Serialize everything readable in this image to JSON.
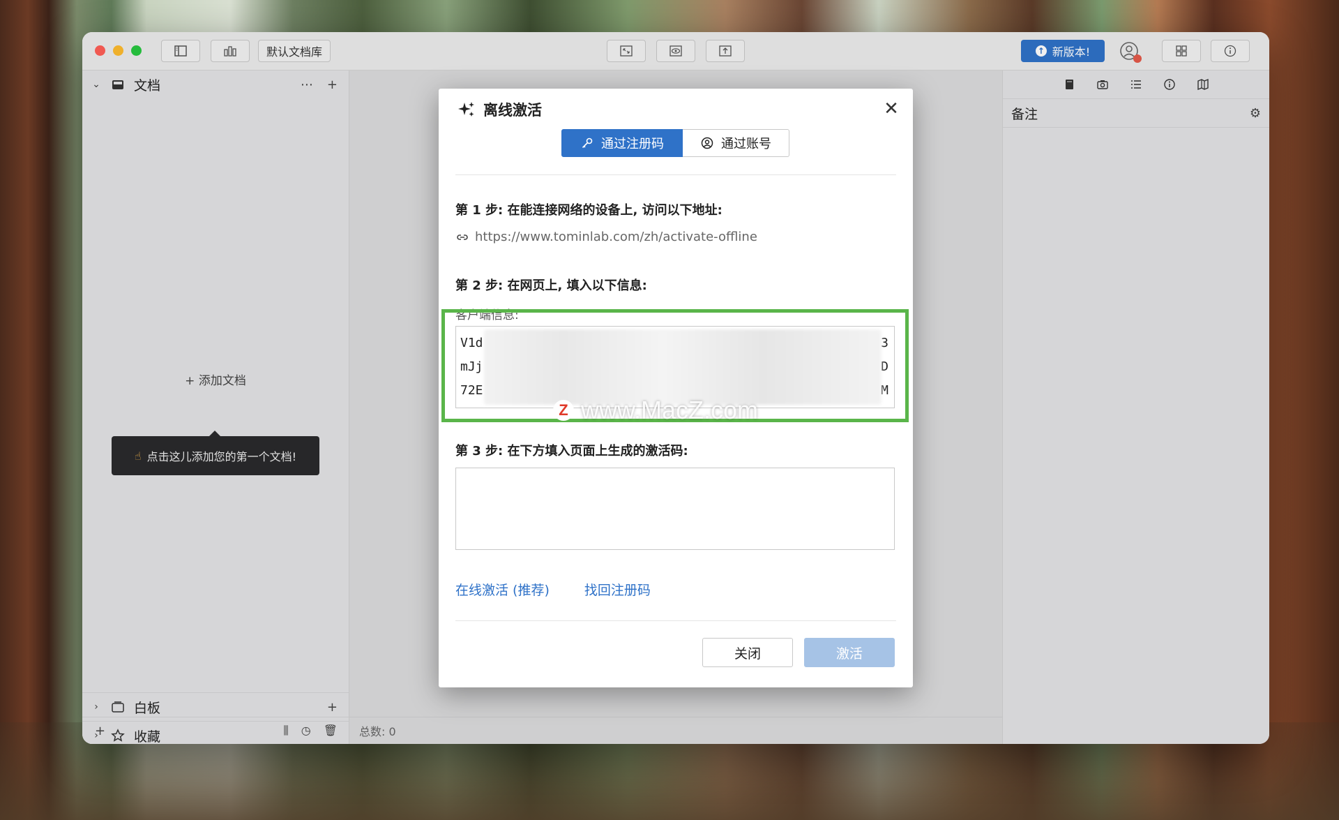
{
  "titlebar": {
    "library_label": "默认文档库",
    "update_label": "新版本!"
  },
  "sidebar": {
    "documents_label": "文档",
    "add_document_label": "添加文档",
    "tooltip": "点击这儿添加您的第一个文档!",
    "whiteboard_label": "白板",
    "favorites_label": "收藏"
  },
  "center": {
    "total_label": "总数: 0"
  },
  "right_panel": {
    "notes_label": "备注"
  },
  "modal": {
    "title": "离线激活",
    "tab_code": "通过注册码",
    "tab_account": "通过账号",
    "step1": "第 1 步: 在能连接网络的设备上, 访问以下地址:",
    "url": "https://www.tominlab.com/zh/activate-offline",
    "step2": "第 2 步: 在网页上, 填入以下信息:",
    "client_info_label": "客户端信息:",
    "client_lines": [
      {
        "start": "V1d",
        "end": "3"
      },
      {
        "start": "mJj",
        "end": "D"
      },
      {
        "start": "72E",
        "end": "M"
      }
    ],
    "step3": "第 3 步: 在下方填入页面上生成的激活码:",
    "online_activate": "在线激活 (推荐)",
    "retrieve_code": "找回注册码",
    "close_button": "关闭",
    "activate_button": "激活"
  },
  "watermark": "www.MacZ.com",
  "colors": {
    "accent": "#2f72c8",
    "highlight": "#5ab54a",
    "disabled_button": "#a6c3e6"
  }
}
